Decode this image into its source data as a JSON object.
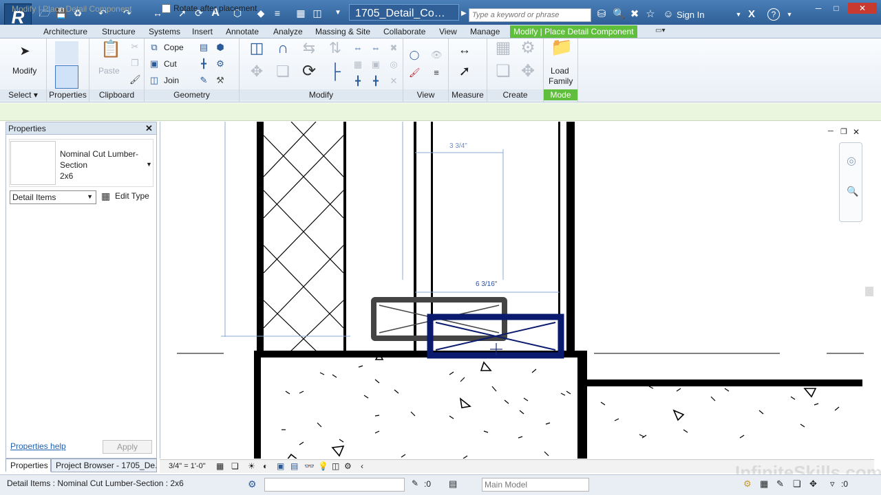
{
  "app": {
    "logo": "R",
    "document_title": "1705_Detail_Compon...",
    "search_placeholder": "Type a keyword or phrase",
    "sign_in": "Sign In",
    "help": "?"
  },
  "tabs": [
    "Architecture",
    "Structure",
    "Systems",
    "Insert",
    "Annotate",
    "Analyze",
    "Massing & Site",
    "Collaborate",
    "View",
    "Manage",
    "Modify | Place Detail Component"
  ],
  "ribbon": {
    "modify_label": "Modify",
    "properties_label": "Properties",
    "paste_label": "Paste",
    "cope_label": "Cope",
    "cut_label": "Cut",
    "join_label": "Join",
    "load_family_line1": "Load",
    "load_family_line2": "Family",
    "panels": {
      "select": "Select",
      "properties": "Properties",
      "clipboard": "Clipboard",
      "geometry": "Geometry",
      "modify": "Modify",
      "view": "View",
      "measure": "Measure",
      "create": "Create",
      "mode": "Mode"
    }
  },
  "options_bar": {
    "context": "Modify | Place Detail Component",
    "rotate_after_placement": "Rotate after placement",
    "rotate_checked": false
  },
  "properties": {
    "header": "Properties",
    "type_line1": "Nominal Cut Lumber-",
    "type_line2": "Section",
    "type_line3": "2x6",
    "category": "Detail Items",
    "edit_type": "Edit Type",
    "help_link": "Properties help",
    "apply": "Apply"
  },
  "bottom_tabs": {
    "properties": "Properties",
    "project_browser": "Project Browser - 1705_De..."
  },
  "canvas": {
    "dim_top": "3 3/4\"",
    "dim_mid": "6 3/16\""
  },
  "view_control": {
    "scale": "3/4\" = 1'-0\""
  },
  "status": {
    "text": "Detail Items : Nominal Cut Lumber-Section : 2x6",
    "worksets": ":0",
    "model": "Main Model",
    "filter": ":0"
  },
  "watermark": "InfiniteSkills.com",
  "colors": {
    "titlebar": "#3a6ea5",
    "context_tab": "#5fbf3c",
    "selection": "#0a1a6e"
  }
}
